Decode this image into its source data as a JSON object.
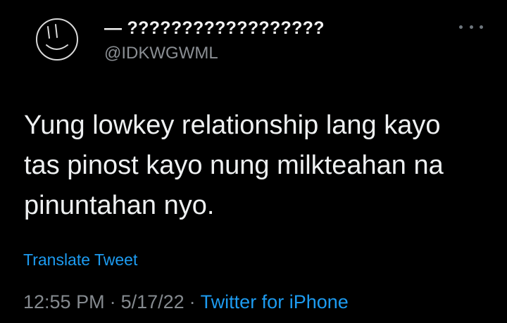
{
  "tweet": {
    "author": {
      "display_name": "— ??????????????????",
      "handle": "@IDKWGWML",
      "avatar_icon": "smiley-doodle-avatar-icon"
    },
    "more_icon": "more-options-icon",
    "text": "Yung lowkey relationship lang kayo\ntas pinost kayo nung milkteahan na\npinuntahan nyo.",
    "translate_label": "Translate Tweet",
    "time": "12:55 PM",
    "date": "5/17/22",
    "separator": "·",
    "source": "Twitter for iPhone"
  },
  "colors": {
    "background": "#000000",
    "text_primary": "#eef0f1",
    "text_secondary": "#858a8f",
    "link": "#1d9bf0"
  }
}
